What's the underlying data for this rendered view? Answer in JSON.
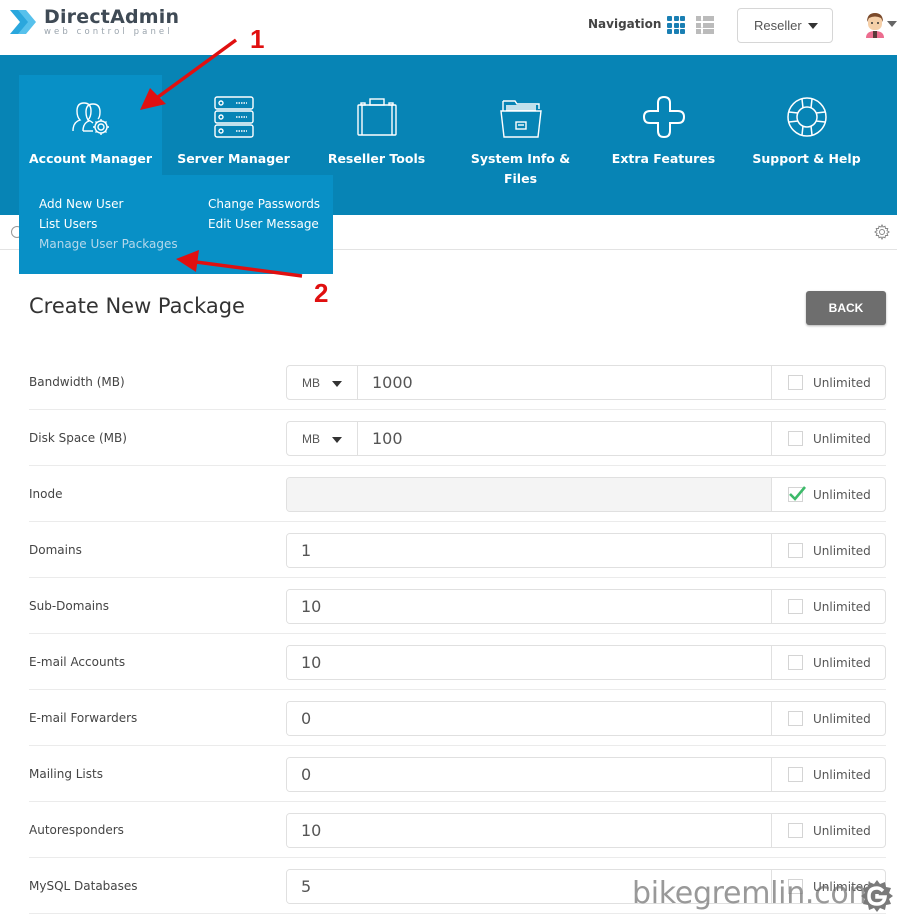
{
  "header": {
    "brand_title": "DirectAdmin",
    "brand_subtitle": "web control panel",
    "navigation_label": "Navigation",
    "role_selected": "Reseller",
    "accent_color": "#0784b5"
  },
  "nav": {
    "items": [
      {
        "label": "Account Manager",
        "icon": "users-gear-icon",
        "active": true
      },
      {
        "label": "Server Manager",
        "icon": "server-icon",
        "active": false
      },
      {
        "label": "Reseller Tools",
        "icon": "briefcase-icon",
        "active": false
      },
      {
        "label": "System Info &",
        "label2": "Files",
        "icon": "folder-icon",
        "active": false
      },
      {
        "label": "Extra Features",
        "icon": "plus-icon",
        "active": false
      },
      {
        "label": "Support & Help",
        "icon": "lifebuoy-icon",
        "active": false
      }
    ],
    "submenu": {
      "add_new_user": "Add New User",
      "list_users": "List Users",
      "manage_user_packages": "Manage User Packages",
      "change_passwords": "Change Passwords",
      "edit_user_message": "Edit User Message"
    }
  },
  "page": {
    "title": "Create New Package",
    "back_label": "BACK"
  },
  "form": {
    "unlimited_label": "Unlimited",
    "rows": [
      {
        "label": "Bandwidth (MB)",
        "unit": "MB",
        "value": "1000",
        "unlimited": false
      },
      {
        "label": "Disk Space (MB)",
        "unit": "MB",
        "value": "100",
        "unlimited": false
      },
      {
        "label": "Inode",
        "value": "",
        "unlimited": true
      },
      {
        "label": "Domains",
        "value": "1",
        "unlimited": false
      },
      {
        "label": "Sub-Domains",
        "value": "10",
        "unlimited": false
      },
      {
        "label": "E-mail Accounts",
        "value": "10",
        "unlimited": false
      },
      {
        "label": "E-mail Forwarders",
        "value": "0",
        "unlimited": false
      },
      {
        "label": "Mailing Lists",
        "value": "0",
        "unlimited": false
      },
      {
        "label": "Autoresponders",
        "value": "10",
        "unlimited": false
      },
      {
        "label": "MySQL Databases",
        "value": "5",
        "unlimited": false
      }
    ]
  },
  "annotations": {
    "step1": "1",
    "step2": "2",
    "color": "#e01010"
  },
  "watermark": {
    "text": "bikegremlin.com"
  }
}
